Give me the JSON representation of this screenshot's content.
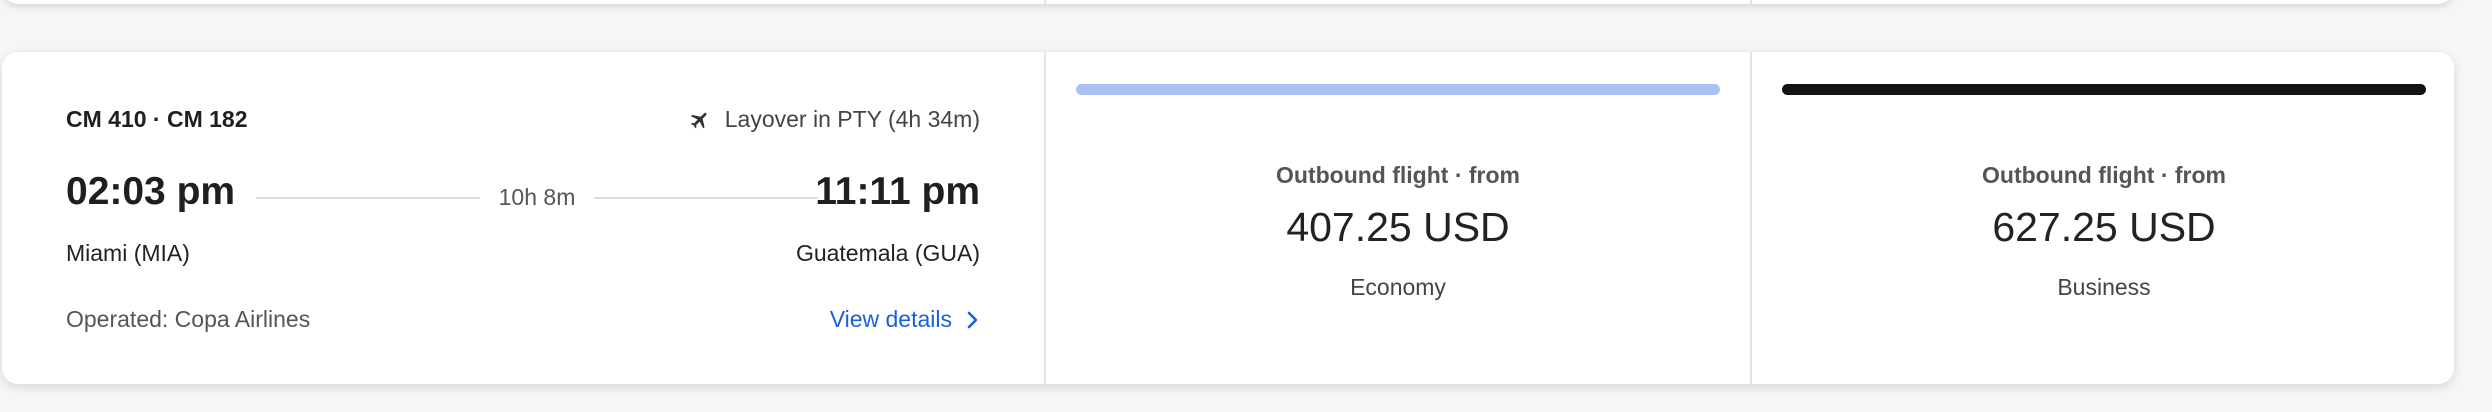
{
  "flight": {
    "flight_numbers": "CM 410 · CM 182",
    "layover": "Layover in PTY (4h 34m)",
    "departure_time": "02:03 pm",
    "arrival_time": "11:11 pm",
    "duration": "10h 8m",
    "departure_airport": "Miami (MIA)",
    "arrival_airport": "Guatemala (GUA)",
    "operated_by": "Operated: Copa Airlines",
    "view_details": "View details"
  },
  "fares": [
    {
      "label": "Outbound flight · from",
      "price": "407.25 USD",
      "cabin": "Economy",
      "accent": "#a8c2f4"
    },
    {
      "label": "Outbound flight · from",
      "price": "627.25 USD",
      "cabin": "Business",
      "accent": "#141414"
    }
  ],
  "icons": {
    "layover": "airplane-icon",
    "details": "chevron-right-icon"
  }
}
